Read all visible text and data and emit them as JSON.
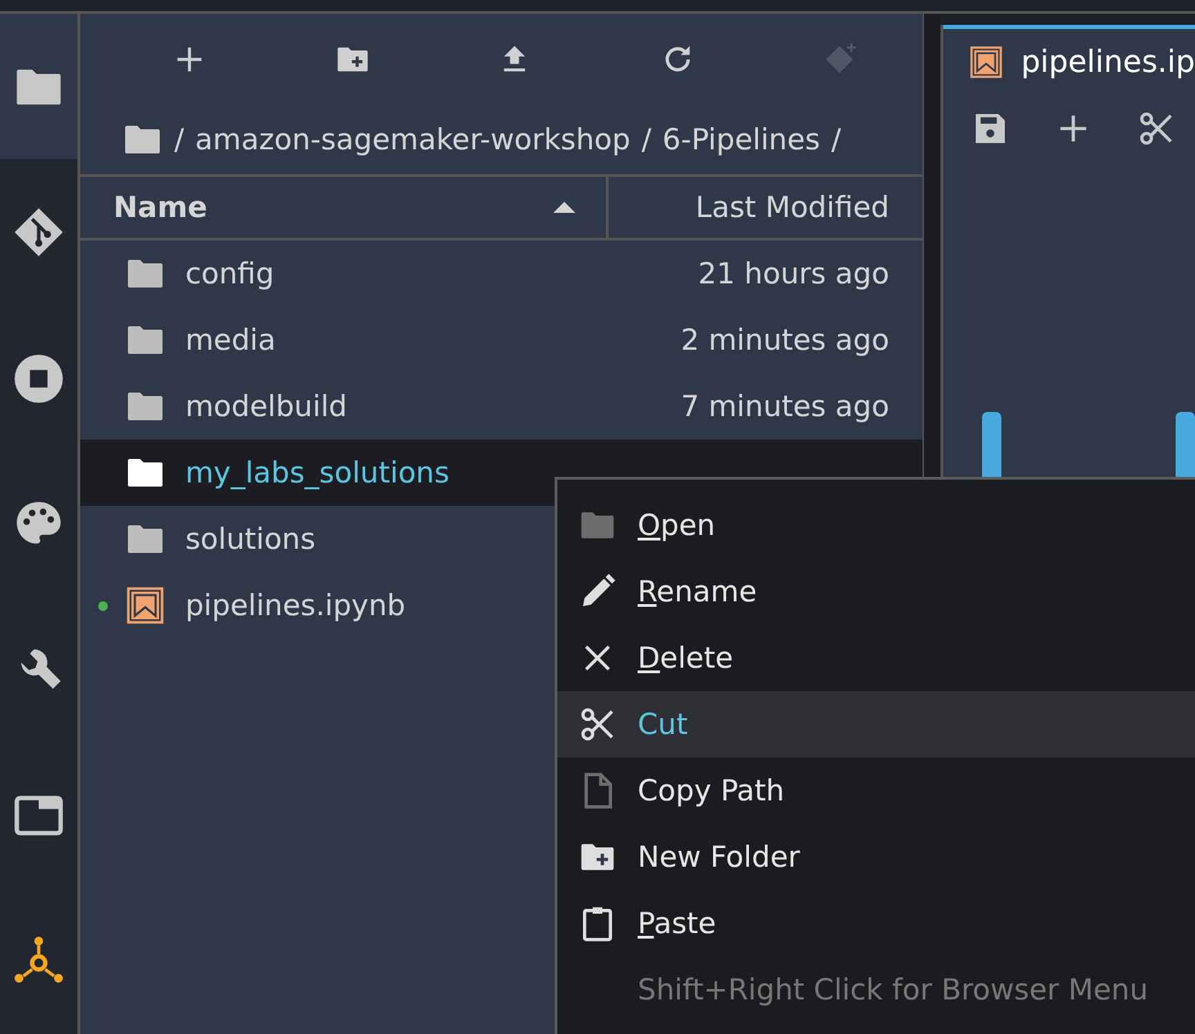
{
  "sidebar": {
    "items": [
      {
        "selected": true
      },
      {
        "selected": false
      },
      {
        "selected": false
      },
      {
        "selected": false
      },
      {
        "selected": false
      },
      {
        "selected": false
      },
      {
        "selected": false
      }
    ]
  },
  "file_browser": {
    "toolbar": [
      {
        "disabled": false
      },
      {
        "disabled": false
      },
      {
        "disabled": false
      },
      {
        "disabled": false
      },
      {
        "disabled": true
      }
    ],
    "breadcrumb": [
      "/",
      "amazon-sagemaker-workshop",
      "/",
      "6-Pipelines",
      "/"
    ],
    "columns": [
      {
        "label": "Name",
        "sorted": true
      },
      {
        "label": "Last Modified",
        "sorted": false
      }
    ],
    "rows": [
      {
        "kind": "folder",
        "name": "config",
        "modified": "21 hours ago",
        "selected": false,
        "running": false
      },
      {
        "kind": "folder",
        "name": "media",
        "modified": "2 minutes ago",
        "selected": false,
        "running": false
      },
      {
        "kind": "folder",
        "name": "modelbuild",
        "modified": "7 minutes ago",
        "selected": false,
        "running": false
      },
      {
        "kind": "folder",
        "name": "my_labs_solutions",
        "selected": true,
        "running": false
      },
      {
        "kind": "folder",
        "name": "solutions",
        "selected": false,
        "running": false
      },
      {
        "kind": "notebook",
        "name": "pipelines.ipynb",
        "selected": false,
        "running": true
      }
    ]
  },
  "editor": {
    "tab": {
      "title": "pipelines.ip",
      "selected": true
    }
  },
  "context_menu": {
    "items": [
      {
        "label": "Open",
        "mnemonic": true,
        "selected": false,
        "disabled": false
      },
      {
        "label": "Rename",
        "mnemonic": true,
        "selected": false,
        "disabled": false
      },
      {
        "label": "Delete",
        "mnemonic": true,
        "selected": false,
        "disabled": false
      },
      {
        "label": "Cut",
        "mnemonic": false,
        "selected": true,
        "disabled": false
      },
      {
        "label": "Copy Path",
        "mnemonic": false,
        "selected": false,
        "disabled": false
      },
      {
        "label": "New Folder",
        "mnemonic": false,
        "selected": false,
        "disabled": false
      },
      {
        "label": "Paste",
        "mnemonic": true,
        "selected": false,
        "disabled": false
      },
      {
        "label": "Shift+Right Click for Browser Menu",
        "mnemonic": false,
        "selected": false,
        "disabled": true
      }
    ]
  }
}
